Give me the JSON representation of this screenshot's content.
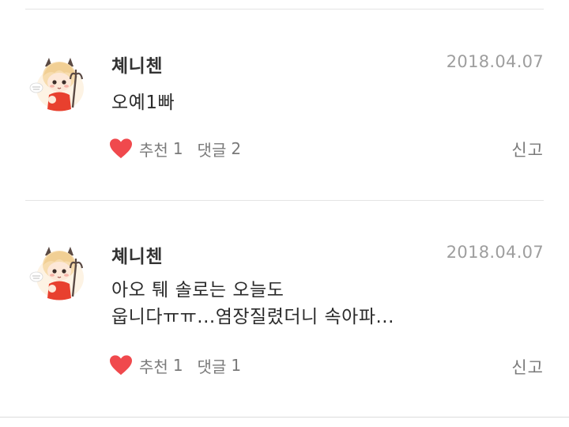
{
  "comments": [
    {
      "author": "쳬니첸",
      "date": "2018.04.07",
      "body_lines": [
        "오예1빠"
      ],
      "like_label": "추천",
      "like_count": "1",
      "reply_label": "댓글",
      "reply_count": "2",
      "report_label": "신고"
    },
    {
      "author": "쳬니첸",
      "date": "2018.04.07",
      "body_lines": [
        "아오 퉤 솔로는 오늘도",
        "웁니다ㅠㅠ...염장질렸더니 속아파..."
      ],
      "like_label": "추천",
      "like_count": "1",
      "reply_label": "댓글",
      "reply_count": "1",
      "report_label": "신고"
    }
  ],
  "colors": {
    "heart": "#f0494d",
    "author": "#333333",
    "meta": "#9e9e9e",
    "divider": "#e4e4e4"
  },
  "icons": {
    "like": "heart-icon",
    "avatar": "devil-chibi-avatar"
  }
}
